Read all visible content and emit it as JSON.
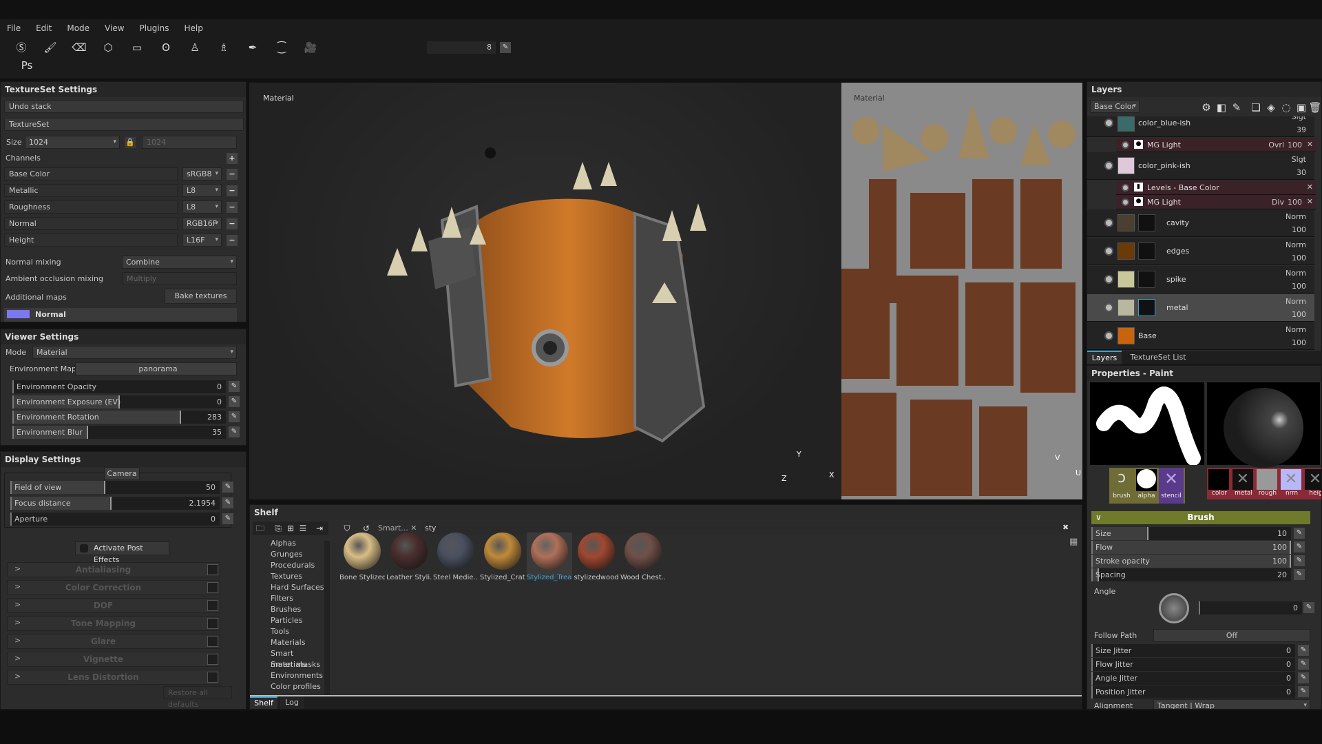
{
  "menu": [
    "File",
    "Edit",
    "Mode",
    "View",
    "Plugins",
    "Help"
  ],
  "toolbar": {
    "brush_size_value": "8",
    "icons": [
      "substance-logo-icon",
      "paint-brush-icon",
      "eraser-icon",
      "projection-icon",
      "polygon-fill-icon",
      "smudge-icon",
      "clone-stamp-icon",
      "material-picker-icon",
      "color-picker-icon",
      "symmetry-icon",
      "camera-icon",
      "photoshop-export-icon"
    ]
  },
  "texture_set_settings": {
    "title": "TextureSet Settings",
    "undo_stack": "Undo stack",
    "texture_set": "TextureSet",
    "size_label": "Size",
    "size_value": "1024",
    "size_linked": "1024",
    "channels_label": "Channels",
    "channels": [
      {
        "name": "Base Color",
        "format": "sRGB8"
      },
      {
        "name": "Metallic",
        "format": "L8"
      },
      {
        "name": "Roughness",
        "format": "L8"
      },
      {
        "name": "Normal",
        "format": "RGB16F"
      },
      {
        "name": "Height",
        "format": "L16F"
      }
    ],
    "normal_mixing_label": "Normal mixing",
    "normal_mixing": "Combine",
    "ao_mixing_label": "Ambient occlusion mixing",
    "ao_mixing": "Multiply",
    "additional_maps_label": "Additional maps",
    "bake_button": "Bake textures",
    "map_normal": "Normal",
    "map_normal_color": "#7b78f0"
  },
  "viewer_settings": {
    "title": "Viewer Settings",
    "mode_label": "Mode",
    "mode": "Material",
    "env_map_label": "Environment Map",
    "env_map": "panorama",
    "sliders": [
      {
        "label": "Environment Opacity",
        "value": "0",
        "fraction": 0
      },
      {
        "label": "Environment Exposure (EV)",
        "value": "0",
        "fraction": 0.5
      },
      {
        "label": "Environment Rotation",
        "value": "283",
        "fraction": 0.79
      },
      {
        "label": "Environment Blur",
        "value": "35",
        "fraction": 0.35
      }
    ]
  },
  "display_settings": {
    "title": "Display Settings",
    "camera": "Camera",
    "sliders": [
      {
        "label": "Field of view",
        "value": "50",
        "fraction": 0.45
      },
      {
        "label": "Focus distance",
        "value": "2.1954",
        "fraction": 0.48
      },
      {
        "label": "Aperture",
        "value": "0",
        "fraction": 0
      }
    ],
    "activate_post": "Activate Post Effects",
    "effects": [
      "Antialiasing",
      "Color Correction",
      "DOF",
      "Tone Mapping",
      "Glare",
      "Vignette",
      "Lens Distortion"
    ],
    "restore": "Restore all defaults"
  },
  "viewport3d": {
    "label": "Material",
    "axes": {
      "x": "X",
      "y": "Y",
      "z": "Z"
    }
  },
  "viewport2d": {
    "label": "Material",
    "axes": {
      "v": "V",
      "u": "U"
    }
  },
  "layers": {
    "title": "Layers",
    "channel": "Base Color",
    "tabs": [
      "Layers",
      "TextureSet List"
    ],
    "items": [
      {
        "name": "color_blue-ish",
        "blend": "Slgt",
        "opacity": "39",
        "color": "#3a6a6a",
        "effects": [
          {
            "name": "MG Light",
            "blend": "Ovrl",
            "opacity": "100"
          }
        ]
      },
      {
        "name": "color_pink-ish",
        "blend": "Slgt",
        "opacity": "30",
        "color": "#e0c8dc",
        "effects": [
          {
            "name": "Levels - Base Color",
            "blend": "",
            "opacity": ""
          },
          {
            "name": "MG Light",
            "blend": "Div",
            "opacity": "100"
          }
        ]
      },
      {
        "name": "cavity",
        "blend": "Norm",
        "opacity": "100",
        "color": "#4a3f30"
      },
      {
        "name": "edges",
        "blend": "Norm",
        "opacity": "100",
        "color": "#6a3a08"
      },
      {
        "name": "spike",
        "blend": "Norm",
        "opacity": "100",
        "color": "#c8c898"
      },
      {
        "name": "metal",
        "blend": "Norm",
        "opacity": "100",
        "color": "#b8b8a0",
        "selected": true
      },
      {
        "name": "Base",
        "blend": "Norm",
        "opacity": "100",
        "color": "#c8640e"
      }
    ]
  },
  "properties": {
    "title": "Properties - Paint",
    "slots_left": [
      "brush",
      "alpha",
      "stencil"
    ],
    "slots_right": [
      "color",
      "metal",
      "rough",
      "nrm",
      "heig"
    ],
    "brush_section": "Brush",
    "sliders": [
      {
        "label": "Size",
        "value": "10",
        "fraction": 0.28
      },
      {
        "label": "Flow",
        "value": "100",
        "fraction": 1
      },
      {
        "label": "Stroke opacity",
        "value": "100",
        "fraction": 1
      },
      {
        "label": "Spacing",
        "value": "20",
        "fraction": 0.03
      }
    ],
    "angle_label": "Angle",
    "angle_value": "0",
    "follow_path_label": "Follow Path",
    "follow_path": "Off",
    "jitters": [
      {
        "label": "Size Jitter",
        "value": "0"
      },
      {
        "label": "Flow Jitter",
        "value": "0"
      },
      {
        "label": "Angle Jitter",
        "value": "0"
      },
      {
        "label": "Position Jitter",
        "value": "0"
      }
    ],
    "alignment_label": "Alignment",
    "alignment": "Tangent | Wrap"
  },
  "shelf": {
    "title": "Shelf",
    "filter_tag": "Smart...",
    "search": "sty",
    "categories": [
      "Alphas",
      "Grunges",
      "Procedurals",
      "Textures",
      "Hard Surfaces",
      "Filters",
      "Brushes",
      "Particles",
      "Tools",
      "Materials",
      "Smart materials",
      "Smart masks",
      "Environments",
      "Color profiles"
    ],
    "items": [
      {
        "name": "Bone Stylized",
        "color": "#d9bd86"
      },
      {
        "name": "Leather Styli...",
        "color": "#4a2e2e"
      },
      {
        "name": "Steel Medie...",
        "color": "#4a5060"
      },
      {
        "name": "Stylized_Crate",
        "color": "#c08a3a"
      },
      {
        "name": "Stylized_Trea...",
        "color": "#b07058",
        "selected": true
      },
      {
        "name": "stylizedwood",
        "color": "#a04830"
      },
      {
        "name": "Wood Chest...",
        "color": "#705048"
      }
    ],
    "tabs": [
      "Shelf",
      "Log"
    ]
  }
}
